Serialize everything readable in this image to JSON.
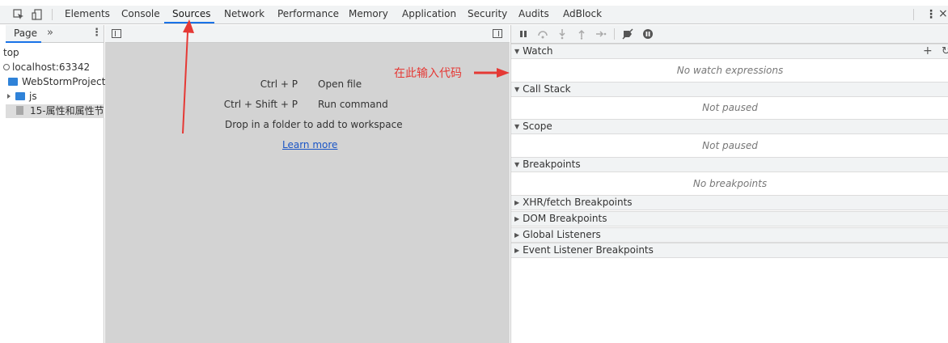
{
  "toolbar": {
    "tabs": [
      "Elements",
      "Console",
      "Sources",
      "Network",
      "Performance",
      "Memory",
      "Application",
      "Security",
      "Audits",
      "AdBlock"
    ],
    "active_tab": "Sources"
  },
  "navigator": {
    "tab_label": "Page",
    "more_label": "»",
    "tree": [
      {
        "label": "top",
        "type": "frame"
      },
      {
        "label": "localhost:63342",
        "type": "origin"
      },
      {
        "label": "WebStormProject",
        "type": "folder"
      },
      {
        "label": "js",
        "type": "folder"
      },
      {
        "label": "15-属性和属性节...",
        "type": "file"
      }
    ]
  },
  "editor": {
    "shortcuts": [
      {
        "key": "Ctrl + P",
        "action": "Open file"
      },
      {
        "key": "Ctrl + Shift + P",
        "action": "Run command"
      }
    ],
    "drop_hint": "Drop in a folder to add to workspace",
    "learn_more": "Learn more"
  },
  "debugger": {
    "sections": [
      {
        "title": "Watch",
        "body": "No watch expressions",
        "expanded": true
      },
      {
        "title": "Call Stack",
        "body": "Not paused",
        "expanded": true
      },
      {
        "title": "Scope",
        "body": "Not paused",
        "expanded": true
      },
      {
        "title": "Breakpoints",
        "body": "No breakpoints",
        "expanded": true
      },
      {
        "title": "XHR/fetch Breakpoints",
        "expanded": false
      },
      {
        "title": "DOM Breakpoints",
        "expanded": false
      },
      {
        "title": "Global Listeners",
        "expanded": false
      },
      {
        "title": "Event Listener Breakpoints",
        "expanded": false
      }
    ]
  },
  "annotation": {
    "text": "在此输入代码",
    "color": "#e53935"
  },
  "colors": {
    "accent": "#1a73e8",
    "editor_bg": "#d3d3d3",
    "toolbar_bg": "#f1f3f4",
    "folder": "#2f82d8"
  }
}
